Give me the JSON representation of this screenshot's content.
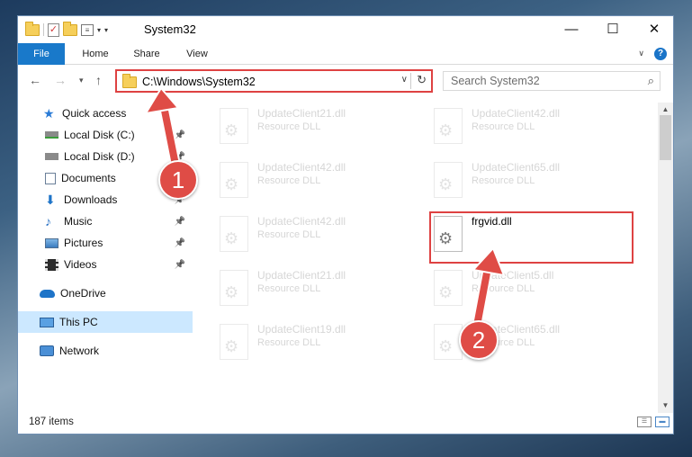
{
  "window": {
    "title": "System32",
    "minimize_glyph": "—",
    "maximize_glyph": "☐",
    "close_glyph": "✕"
  },
  "qat": {
    "check_glyph": "✓",
    "props_glyph": "≡",
    "dropdown_glyph": "▾",
    "customize_glyph": "▾"
  },
  "ribbon": {
    "tabs": [
      "File",
      "Home",
      "Share",
      "View"
    ],
    "collapse_glyph": "∨",
    "help_glyph": "?"
  },
  "nav": {
    "back_glyph": "←",
    "forward_glyph": "→",
    "recent_glyph": "▾",
    "up_glyph": "↑"
  },
  "address": {
    "path": "C:\\Windows\\System32",
    "dropdown_glyph": "∨",
    "refresh_glyph": "↻"
  },
  "search": {
    "placeholder": "Search System32",
    "icon_glyph": "⌕"
  },
  "sidebar": {
    "items": [
      {
        "label": "Quick access",
        "icon": "star-icon"
      },
      {
        "label": "Local Disk (C:)",
        "icon": "drive-icon",
        "pinned": true
      },
      {
        "label": "Local Disk (D:)",
        "icon": "drive-icon",
        "pinned": true
      },
      {
        "label": "Documents",
        "icon": "document-icon",
        "pinned": true
      },
      {
        "label": "Downloads",
        "icon": "download-icon",
        "pinned": true
      },
      {
        "label": "Music",
        "icon": "music-icon",
        "pinned": true
      },
      {
        "label": "Pictures",
        "icon": "picture-icon",
        "pinned": true
      },
      {
        "label": "Videos",
        "icon": "video-icon",
        "pinned": true
      },
      {
        "label": "OneDrive",
        "icon": "cloud-icon"
      },
      {
        "label": "This PC",
        "icon": "computer-icon",
        "selected": true
      },
      {
        "label": "Network",
        "icon": "network-icon"
      }
    ],
    "pin_glyph": "📌"
  },
  "files": [
    {
      "name": "UpdateClient21.dll",
      "type": "Resource DLL"
    },
    {
      "name": "UpdateClient42.dll",
      "type": "Resource DLL"
    },
    {
      "name": "UpdateClient42.dll",
      "type": "Resource DLL"
    },
    {
      "name": "UpdateClient65.dll",
      "type": "Resource DLL"
    },
    {
      "name": "UpdateClient42.dll",
      "type": "Resource DLL"
    },
    {
      "name": "frgvid.dll",
      "type": ""
    },
    {
      "name": "UpdateClient21.dll",
      "type": "Resource DLL"
    },
    {
      "name": "UpdateClient5.dll",
      "type": "Resource DLL"
    },
    {
      "name": "UpdateClient19.dll",
      "type": "Resource DLL"
    },
    {
      "name": "UpdateClient65.dll",
      "type": "Resource DLL"
    }
  ],
  "status": {
    "item_count": "187 items",
    "details_view_glyph": "☰",
    "tiles_view_glyph": "▬"
  },
  "scrollbar": {
    "up_glyph": "▲",
    "down_glyph": "▼"
  },
  "callouts": [
    "1",
    "2"
  ],
  "colors": {
    "accent": "#1979ca",
    "highlight_red": "#de4242",
    "callout_red": "#df4c46",
    "selection": "#cce8ff"
  }
}
